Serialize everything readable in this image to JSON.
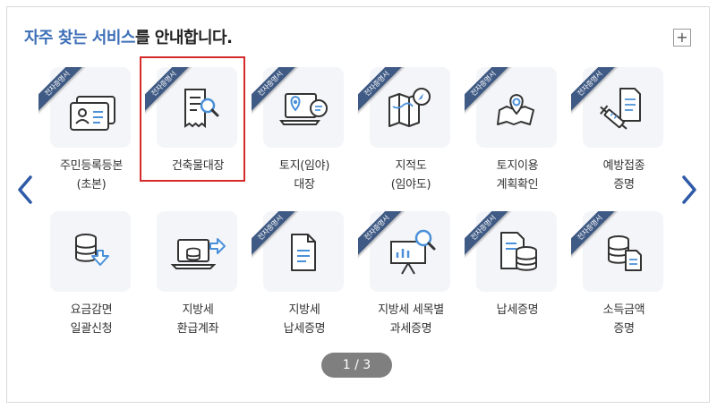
{
  "heading": {
    "accent": "자주 찾는 서비스",
    "rest": "를 안내합니다."
  },
  "more_button": "+",
  "ribbon_text": "전자증명서",
  "pagination": {
    "text": "1 / 3"
  },
  "services": [
    {
      "line1": "주민등록등본",
      "line2": "(초본)",
      "icon": "id-card-icon",
      "ribbon": true
    },
    {
      "line1": "건축물대장",
      "line2": "",
      "icon": "receipt-search-icon",
      "ribbon": true,
      "selected": true
    },
    {
      "line1": "토지(임야)",
      "line2": "대장",
      "icon": "laptop-location-icon",
      "ribbon": true
    },
    {
      "line1": "지적도",
      "line2": "(임야도)",
      "icon": "map-compass-icon",
      "ribbon": true
    },
    {
      "line1": "토지이용",
      "line2": "계획확인",
      "icon": "map-pin-icon",
      "ribbon": true
    },
    {
      "line1": "예방접종",
      "line2": "증명",
      "icon": "syringe-document-icon",
      "ribbon": true
    },
    {
      "line1": "요금감면",
      "line2": "일괄신청",
      "icon": "database-download-icon",
      "ribbon": false
    },
    {
      "line1": "지방세",
      "line2": "환급계좌",
      "icon": "monitor-coins-icon",
      "ribbon": false
    },
    {
      "line1": "지방세",
      "line2": "납세증명",
      "icon": "document-icon",
      "ribbon": true
    },
    {
      "line1": "지방세 세목별",
      "line2": "과세증명",
      "icon": "presentation-chart-icon",
      "ribbon": true
    },
    {
      "line1": "납세증명",
      "line2": "",
      "icon": "document-database-icon",
      "ribbon": true
    },
    {
      "line1": "소득금액",
      "line2": "증명",
      "icon": "database-document-icon",
      "ribbon": true
    }
  ],
  "colors": {
    "accent": "#3d6fb8",
    "ribbon": "#3f5a84",
    "icon_stroke": "#333333",
    "icon_blue": "#4a90d9",
    "selected_border": "#d62b2b"
  }
}
